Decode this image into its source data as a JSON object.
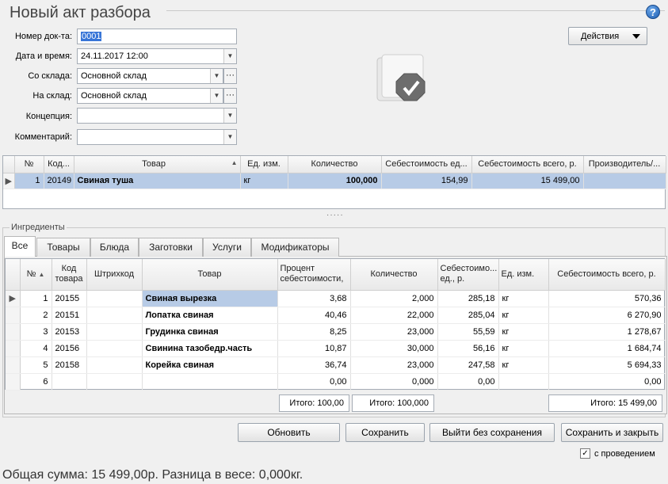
{
  "window": {
    "title": "Новый акт разбора",
    "help_label": "?"
  },
  "form": {
    "doc_number_label": "Номер док-та:",
    "doc_number": "0001",
    "datetime_label": "Дата и время:",
    "datetime": "24.11.2017 12:00",
    "from_store_label": "Со склада:",
    "from_store": "Основной склад",
    "to_store_label": "На склад:",
    "to_store": "Основной склад",
    "concept_label": "Концепция:",
    "concept": "",
    "comment_label": "Комментарий:",
    "comment": "",
    "more_label": "···"
  },
  "actions": {
    "label": "Действия"
  },
  "product_grid": {
    "headers": [
      "№",
      "Код...",
      "Товар",
      "Ед. изм.",
      "Количество",
      "Себестоимость ед...",
      "Себестоимость всего, р.",
      "Производитель/..."
    ],
    "rows": [
      {
        "n": "1",
        "code": "20149",
        "name": "Свиная туша",
        "unit": "кг",
        "qty": "100,000",
        "cost_unit": "154,99",
        "cost_total": "15 499,00",
        "producer": ""
      }
    ]
  },
  "splitter_label": "·····",
  "ingredients": {
    "group_title": "Ингредиенты",
    "tabs": [
      "Все",
      "Товары",
      "Блюда",
      "Заготовки",
      "Услуги",
      "Модификаторы"
    ],
    "headers": [
      "№",
      "Код товара",
      "Штрихкод",
      "Товар",
      "Процент себестоимости,",
      "Количество",
      "Себестоимо... ед., р.",
      "Ед. изм.",
      "Себестоимость всего, р."
    ],
    "rows": [
      {
        "n": "1",
        "code": "20155",
        "barcode": "",
        "name": "Свиная вырезка",
        "pct": "3,68",
        "qty": "2,000",
        "cost_unit": "285,18",
        "unit": "кг",
        "cost_total": "570,36"
      },
      {
        "n": "2",
        "code": "20151",
        "barcode": "",
        "name": "Лопатка свиная",
        "pct": "40,46",
        "qty": "22,000",
        "cost_unit": "285,04",
        "unit": "кг",
        "cost_total": "6 270,90"
      },
      {
        "n": "3",
        "code": "20153",
        "barcode": "",
        "name": "Грудинка свиная",
        "pct": "8,25",
        "qty": "23,000",
        "cost_unit": "55,59",
        "unit": "кг",
        "cost_total": "1 278,67"
      },
      {
        "n": "4",
        "code": "20156",
        "barcode": "",
        "name": "Свинина тазобедр.часть",
        "pct": "10,87",
        "qty": "30,000",
        "cost_unit": "56,16",
        "unit": "кг",
        "cost_total": "1 684,74"
      },
      {
        "n": "5",
        "code": "20158",
        "barcode": "",
        "name": "Корейка свиная",
        "pct": "36,74",
        "qty": "23,000",
        "cost_unit": "247,58",
        "unit": "кг",
        "cost_total": "5 694,33"
      },
      {
        "n": "6",
        "code": "",
        "barcode": "",
        "name": "",
        "pct": "0,00",
        "qty": "0,000",
        "cost_unit": "0,00",
        "unit": "",
        "cost_total": "0,00"
      }
    ],
    "totals": {
      "pct": "Итого: 100,00",
      "qty": "Итого: 100,000",
      "cost_total": "Итого: 15 499,00"
    }
  },
  "buttons": {
    "refresh": "Обновить",
    "save": "Сохранить",
    "exit_no_save": "Выйти без сохранения",
    "save_close": "Сохранить и закрыть"
  },
  "post_checkbox": {
    "label": "с проведением",
    "checked": true,
    "mark": "✓"
  },
  "footer": {
    "summary": "Общая сумма: 15 499,00р. Разница в весе: 0,000кг."
  },
  "colors": {
    "selected_row": "#b7cbe6",
    "highlight_cell": "#b7cbe6",
    "accent": "#3875d7"
  }
}
